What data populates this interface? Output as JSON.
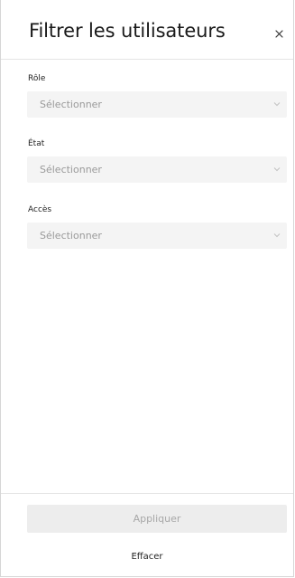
{
  "header": {
    "title": "Filtrer les utilisateurs",
    "close_icon": "close-icon"
  },
  "filters": [
    {
      "label": "Rôle",
      "placeholder": "Sélectionner",
      "icon": "chevron-down-icon"
    },
    {
      "label": "État",
      "placeholder": "Sélectionner",
      "icon": "chevron-down-icon"
    },
    {
      "label": "Accès",
      "placeholder": "Sélectionner",
      "icon": "chevron-down-icon"
    }
  ],
  "footer": {
    "apply_label": "Appliquer",
    "clear_label": "Effacer"
  },
  "colors": {
    "select_background": "#f4f4f4",
    "apply_disabled_background": "#ededed",
    "placeholder_text": "#9a9a9a",
    "divider": "#e4e4e4"
  }
}
